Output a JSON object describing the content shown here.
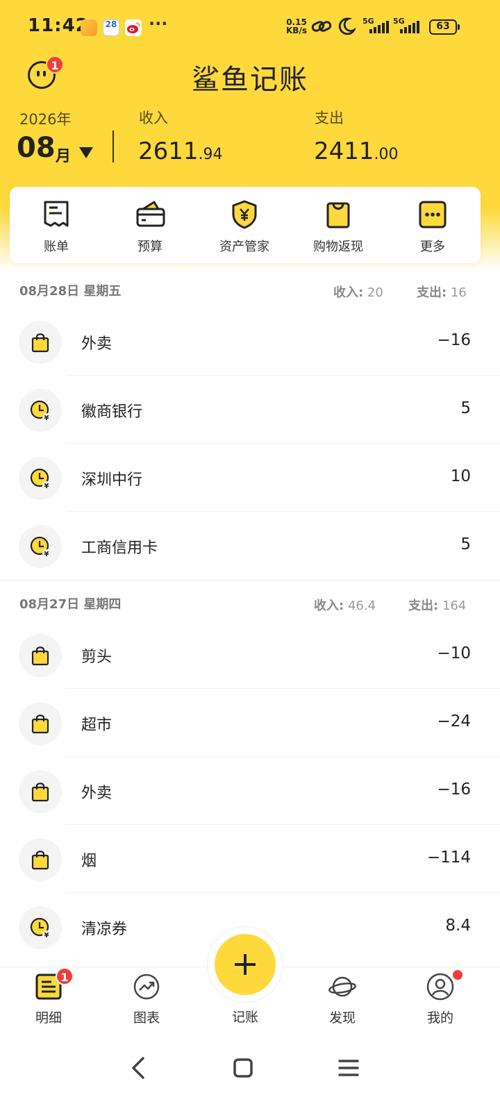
{
  "status_bar": {
    "time": "11:42",
    "calendar_app": "28",
    "more": "···",
    "net_speed_value": "0.15",
    "net_speed_unit": "KB/s",
    "sim1": "5G",
    "sim2": "5G",
    "battery": "63"
  },
  "header": {
    "title": "鲨鱼记账",
    "notification_badge": "1",
    "year": "2026年",
    "month": "08",
    "month_unit": "月",
    "income_label": "收入",
    "income_int": "2611",
    "income_dec": ".94",
    "expense_label": "支出",
    "expense_int": "2411",
    "expense_dec": ".00"
  },
  "menu": {
    "items": [
      {
        "label": "账单",
        "icon": "bill-icon"
      },
      {
        "label": "预算",
        "icon": "wallet-icon"
      },
      {
        "label": "资产管家",
        "icon": "shield-yen-icon"
      },
      {
        "label": "购物返现",
        "icon": "shopping-bag-icon"
      },
      {
        "label": "更多",
        "icon": "more-icon"
      }
    ]
  },
  "days": [
    {
      "date": "08月28日 星期五",
      "income_label": "收入:",
      "income": "20",
      "expense_label": "支出:",
      "expense": "16",
      "entries": [
        {
          "name": "外卖",
          "amount": "−16",
          "icon": "shopping-bag-icon"
        },
        {
          "name": "徽商银行",
          "amount": "5",
          "icon": "clock-yen-icon"
        },
        {
          "name": "深圳中行",
          "amount": "10",
          "icon": "clock-yen-icon"
        },
        {
          "name": "工商信用卡",
          "amount": "5",
          "icon": "clock-yen-icon"
        }
      ]
    },
    {
      "date": "08月27日 星期四",
      "income_label": "收入:",
      "income": "46.4",
      "expense_label": "支出:",
      "expense": "164",
      "entries": [
        {
          "name": "剪头",
          "amount": "−10",
          "icon": "shopping-bag-icon"
        },
        {
          "name": "超市",
          "amount": "−24",
          "icon": "shopping-bag-icon"
        },
        {
          "name": "外卖",
          "amount": "−16",
          "icon": "shopping-bag-icon"
        },
        {
          "name": "烟",
          "amount": "−114",
          "icon": "shopping-bag-icon"
        },
        {
          "name": "清凉券",
          "amount": "8.4",
          "icon": "clock-yen-icon"
        }
      ]
    }
  ],
  "bottom_nav": {
    "details": "明细",
    "details_badge": "1",
    "charts": "图表",
    "add": "记账",
    "discover": "发现",
    "mine": "我的"
  },
  "colors": {
    "brand_yellow": "#FDD93C",
    "badge_red": "#F23C3C"
  }
}
